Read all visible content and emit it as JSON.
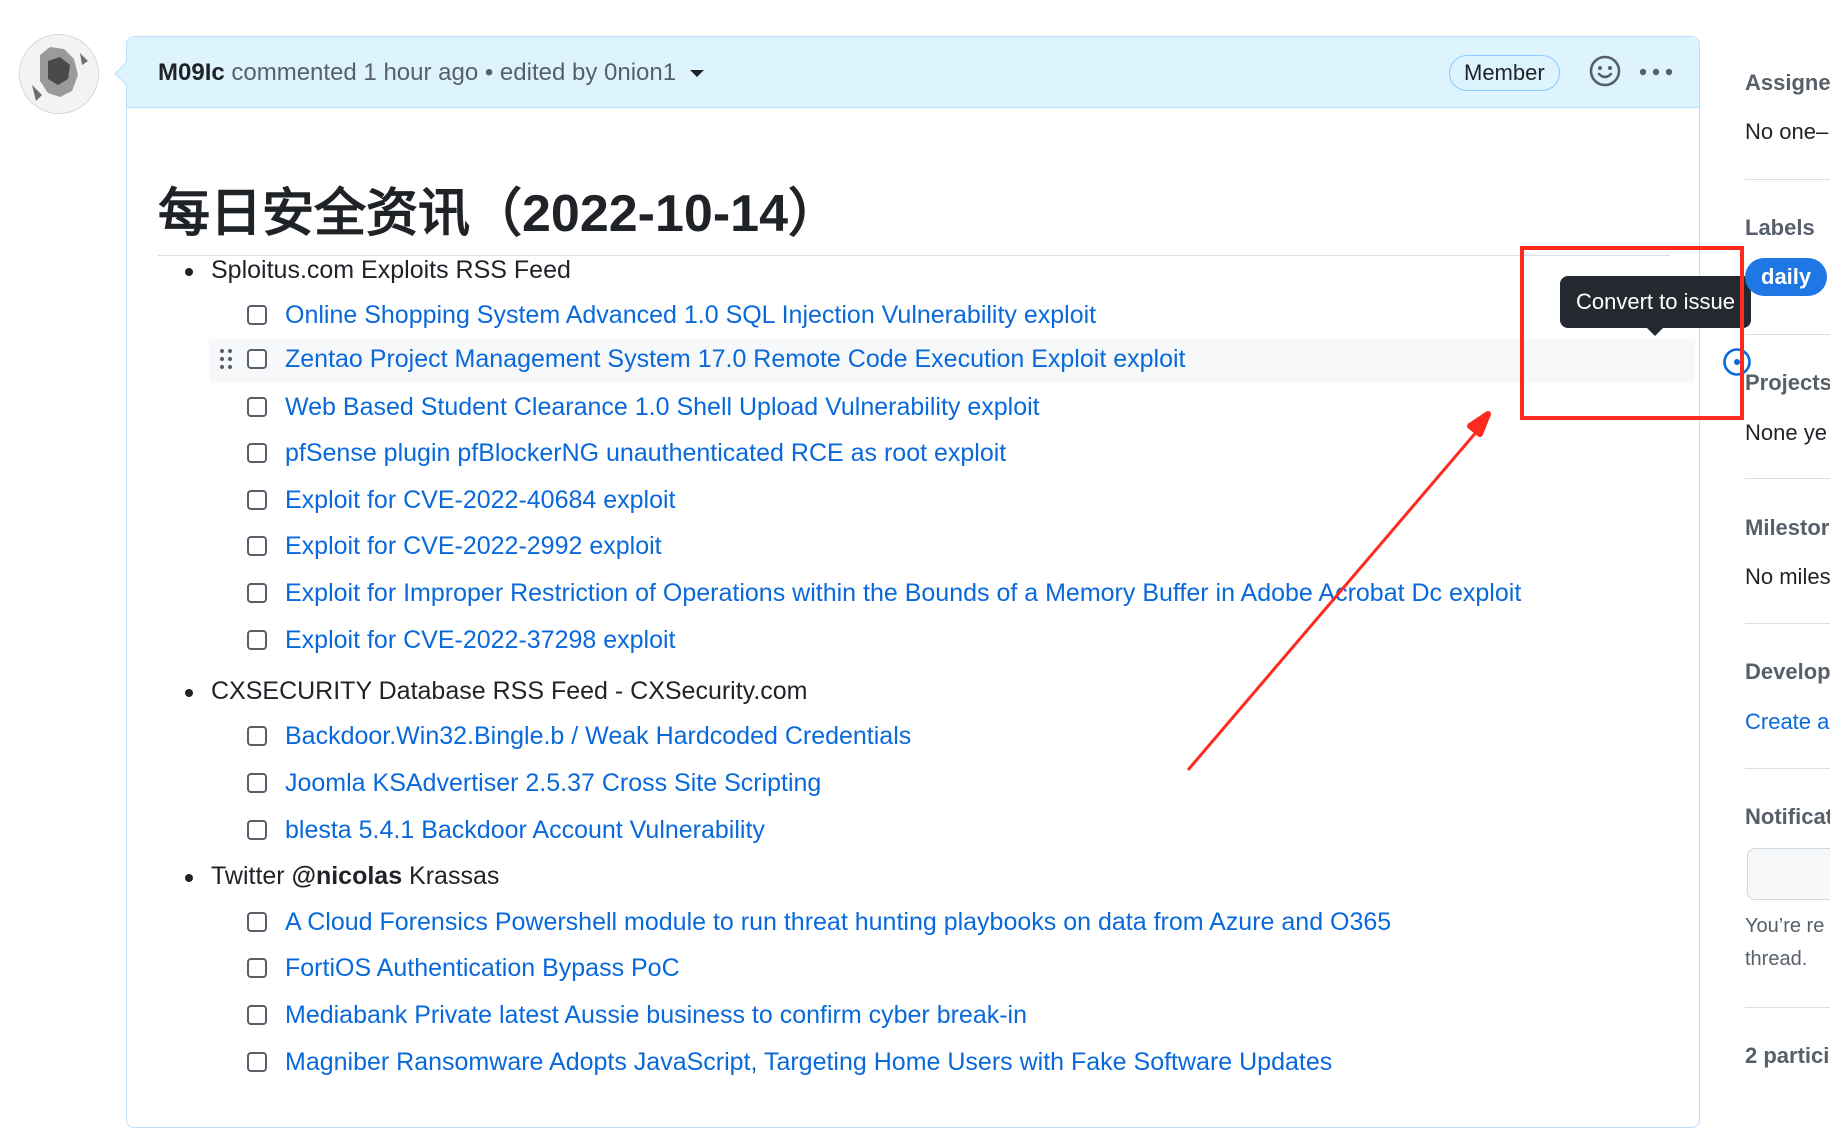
{
  "comment": {
    "author": "M09Ic",
    "meta": "commented 1 hour ago • edited by 0nion1",
    "badge": "Member"
  },
  "title": "每日安全资讯（2022-10-14）",
  "sections": [
    {
      "label": "Sploitus.com Exploits RSS Feed",
      "tasks": [
        "Online Shopping System Advanced 1.0 SQL Injection Vulnerability exploit",
        "Zentao Project Management System 17.0 Remote Code Execution Exploit exploit",
        "Web Based Student Clearance 1.0 Shell Upload Vulnerability exploit",
        "pfSense plugin pfBlockerNG unauthenticated RCE as root exploit",
        "Exploit for CVE-2022-40684 exploit",
        "Exploit for CVE-2022-2992 exploit",
        "Exploit for Improper Restriction of Operations within the Bounds of a Memory Buffer in Adobe Acrobat Dc exploit",
        "Exploit for CVE-2022-37298 exploit"
      ]
    },
    {
      "label": "CXSECURITY Database RSS Feed - CXSecurity.com",
      "tasks": [
        "Backdoor.Win32.Bingle.b / Weak Hardcoded Credentials",
        "Joomla KSAdvertiser 2.5.37 Cross Site Scripting",
        "blesta 5.4.1 Backdoor Account Vulnerability"
      ]
    },
    {
      "label_prefix": "Twitter ",
      "label_handle": "@nicolas",
      "label_suffix": " Krassas",
      "tasks": [
        "A Cloud Forensics Powershell module to run threat hunting playbooks on data from Azure and O365",
        "FortiOS Authentication Bypass PoC",
        "Mediabank Private latest Aussie business to confirm cyber break-in",
        "Magniber Ransomware Adopts JavaScript, Targeting Home Users with Fake Software Updates"
      ]
    }
  ],
  "tooltip": "Convert to issue",
  "sidebar": {
    "assignees_heading": "Assignee",
    "assignees_value": "No one–",
    "labels_heading": "Labels",
    "label_daily": "daily",
    "projects_heading": "Projects",
    "projects_value": "None ye",
    "milestone_heading": "Milestor",
    "milestone_value": "No miles",
    "development_heading": "Develop",
    "development_link": "Create a",
    "notifications_heading": "Notificat",
    "notifications_note_1": "You’re re",
    "notifications_note_2": "thread.",
    "participants_heading": "2 partici"
  },
  "colors": {
    "header_bg": "#ddf4ff",
    "link": "#0969da",
    "label_daily": "#1f77e6",
    "annotation": "#ff2a1f"
  }
}
